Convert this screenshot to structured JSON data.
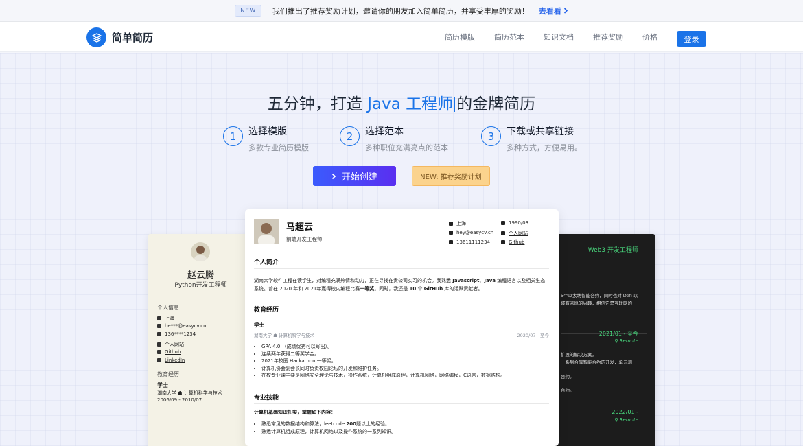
{
  "announcement": {
    "badge": "NEW",
    "text": "我们推出了推荐奖励计划，邀请你的朋友加入简单简历，并享受丰厚的奖励！",
    "link": "去看看"
  },
  "header": {
    "logo_text": "简单简历",
    "nav": [
      "简历模版",
      "简历范本",
      "知识文档",
      "推荐奖励",
      "价格"
    ],
    "login": "登录",
    "accent": "#1a73e8"
  },
  "hero": {
    "title_prefix": "五分钟，打造",
    "title_highlight": "Java 工程师",
    "title_suffix": "的金牌简历",
    "steps": [
      {
        "num": "1",
        "title": "选择模版",
        "desc": "多款专业简历模版"
      },
      {
        "num": "2",
        "title": "选择范本",
        "desc": "多种职位充满亮点的范本"
      },
      {
        "num": "3",
        "title": "下载或共享链接",
        "desc": "多种方式，方便易用。"
      }
    ],
    "start_button": "开始创建",
    "referral_button": "NEW: 推荐奖励计划"
  },
  "left_resume": {
    "name": "赵云腾",
    "role": "Python开发工程师",
    "info_title": "个人信息",
    "info": [
      "上海",
      "he***@easycv.cn",
      "136****1234"
    ],
    "links": [
      "个人网站",
      "Github",
      "LinkedIn"
    ],
    "edu_title": "教育经历",
    "edu_degree": "学士",
    "edu_school": "湖南大学 ☗ 计算机科学与技术",
    "edu_dates": "2006/09 - 2010/07"
  },
  "right_resume": {
    "role": "Web3 开发工程师",
    "lines": [
      "5个以太坊智能合约，同时也对 Defi 以",
      "域有浓厚的兴趣，相信它是互联网的"
    ],
    "date1": "2021/01 - 至今",
    "remote1": "Remote",
    "lines2": [
      "扩展的解决方案。",
      "一系列合库智能合约的开发，单元测",
      "合约。",
      "合约。"
    ],
    "date2": "2022/01 -",
    "remote2": "Remote"
  },
  "center_resume": {
    "name": "马超云",
    "role": "前端开发工程师",
    "location": "上海",
    "birth": "1990/03",
    "email": "hey@easycv.cn",
    "website": "个人网站",
    "phone": "13611111234",
    "github": "Github",
    "summary_title": "个人简介",
    "summary_line1_a": "湖南大学软件工程在读学生，对编程充满热情和动力，正在寻找在贵公司实习的机会。我熟悉",
    "summary_line1_b": "Javascript",
    "summary_line1_c": "、",
    "summary_line1_d": "Java",
    "summary_line1_e": "编程语言以及相关生态",
    "summary_line2_a": "系统。曾在 2020 年和 2021年赢得校内编程比赛",
    "summary_line2_b": "一等奖",
    "summary_line2_c": "。同时，我还是",
    "summary_line2_d": "10",
    "summary_line2_e": "个",
    "summary_line2_f": "GitHub",
    "summary_line2_g": "库的活跃贡献者。",
    "edu_title": "教育经历",
    "edu_degree": "学士",
    "edu_meta": "湖南大学  ☗ 计算机科学与技术",
    "edu_dates": "2020/07 - 至今",
    "edu_items": [
      "GPA 4.0 （成绩优秀可以写出）。",
      "连续两年获得二等奖学金。",
      "2021年校园 Hackathon 一等奖。",
      "计算机协会副会长同时负责校园论坛的开发和维护任务。",
      "在校专业课主要是网络安全理论与技术，操作系统，计算机组成原理，计算机网络，网络编程，C语言，数据结构。"
    ],
    "skills_title": "专业技能",
    "skills_intro": "计算机基础知识扎实，掌握如下内容：",
    "skill1_a": "熟悉常见的数据结构和算法，leetcode",
    "skill1_b": "200",
    "skill1_c": "题以上的经验。",
    "skill2": "熟悉计算机组成原理，计算机网络以及操作系统的一系列知识。"
  }
}
